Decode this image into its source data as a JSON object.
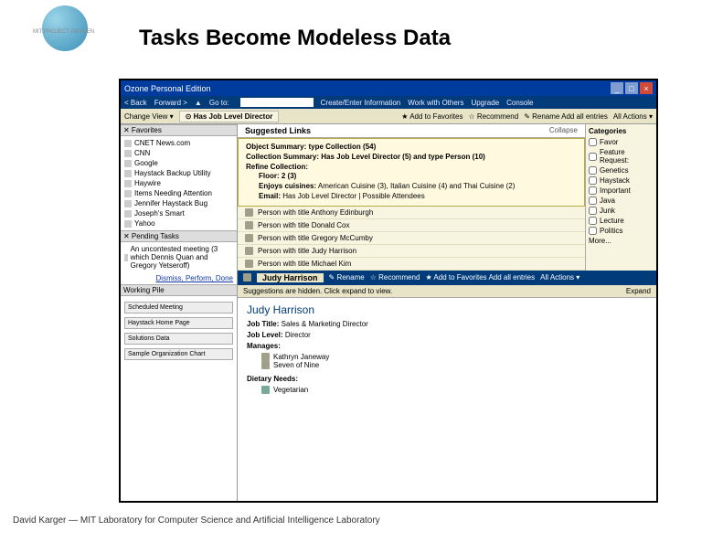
{
  "slide": {
    "title": "Tasks Become Modeless Data",
    "logo": "MIT PROJECT OXYGEN",
    "footer": "David Karger  —  MIT Laboratory for Computer Science and Artificial Intelligence Laboratory"
  },
  "app": {
    "window_title": "Ozone Personal Edition",
    "nav": {
      "back": "< Back",
      "forward": "Forward >",
      "goto": "Go to:",
      "create": "Create/Enter Information",
      "work": "Work with Others",
      "upgrade": "Upgrade",
      "console": "Console"
    },
    "directorbar": {
      "change": "Change View ▾",
      "main": "Has Job Level Director",
      "fav": "★ Add to Favorites",
      "reco": "☆ Recommend",
      "rename": "✎ Rename Add all entries",
      "actions": "All Actions ▾"
    },
    "favorites": {
      "title": "✕  Favorites",
      "items": [
        "CNET News.com",
        "CNN",
        "Google",
        "Haystack Backup Utility",
        "Haywire",
        "Items Needing Attention",
        "Jennifer Haystack Bug",
        "Joseph's Smart",
        "Yahoo"
      ]
    },
    "pending": {
      "title": "✕  Pending Tasks",
      "item": "An uncontested meeting (3 which Dennis Quan and Gregory Yetseroff)",
      "link": "Dismiss, Perform, Done"
    },
    "working": {
      "title": "Working Pile",
      "items": [
        "Scheduled Meeting",
        "Haystack Home Page",
        "Solutions Data",
        "Sample Organization Chart"
      ]
    },
    "suggest": {
      "title": "Suggested Links",
      "collapse": "Collapse",
      "object": "Object Summary: type Collection (54)",
      "collection": "Collection Summary: Has Job Level Director (5) and type Person (10)",
      "refine": "Refine Collection:",
      "floor": "Floor: 2 (3)",
      "enjoys": "Enjoys cuisines: American Cuisine (3), Italian Cuisine (4) and Thai Cuisine (2)",
      "email": "Email: Has Job Level Director | Possible Attendees",
      "people": [
        "Person with title Anthony Edinburgh",
        "Person with title Donald Cox",
        "Person with title Gregory McCumby",
        "Person with title Judy Harrison",
        "Person with title Michael Kim"
      ]
    },
    "judy": {
      "name": "Judy Harrison",
      "rename": "✎ Rename",
      "reco": "☆ Recommend",
      "fav": "★ Add to Favorites Add all entries",
      "actions": "All Actions ▾",
      "hint": "Suggestions are hidden. Click expand to view.",
      "expand": "Expand",
      "fields": {
        "jobtitle_l": "Job Title:",
        "jobtitle": "Sales & Marketing Director",
        "joblevel_l": "Job Level:",
        "joblevel": "Director",
        "manages_l": "Manages:",
        "manages": [
          "Kathryn Janeway",
          "Seven of Nine"
        ],
        "dietary_l": "Dietary Needs:",
        "dietary": "Vegetarian"
      }
    },
    "categories": {
      "title": "Categories",
      "items": [
        "Favor",
        "Feature Request:",
        "Genetics",
        "Haystack",
        "Important",
        "Java",
        "Junk",
        "Lecture",
        "Politics",
        "More..."
      ]
    }
  }
}
